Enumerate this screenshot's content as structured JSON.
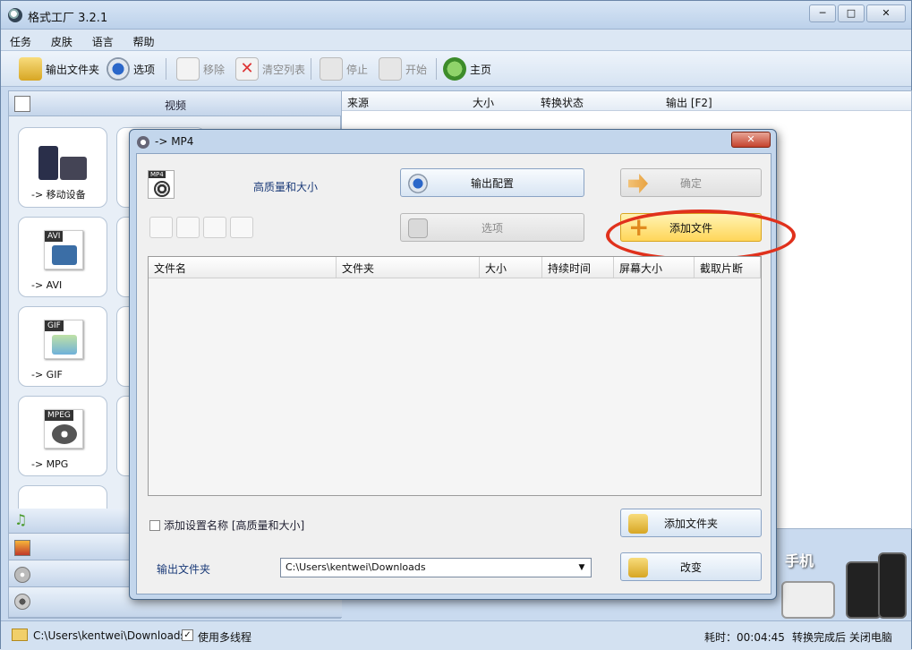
{
  "app": {
    "title": "格式工厂 3.2.1"
  },
  "window_controls": {
    "minimize": "─",
    "maximize": "□",
    "close": "✕"
  },
  "menu": [
    "任务",
    "皮肤",
    "语言",
    "帮助"
  ],
  "toolbar": {
    "output_folder": "输出文件夹",
    "options": "选项",
    "remove": "移除",
    "clear_list": "清空列表",
    "stop": "停止",
    "start": "开始",
    "home": "主页"
  },
  "left_panel": {
    "video_header": "视频",
    "tiles": [
      "-> 移动设备",
      "-> AVI",
      "-> GIF",
      "-> MPG"
    ],
    "tile_tags": [
      "AVI",
      "GIF",
      "MPEG"
    ]
  },
  "task_list": {
    "columns": [
      "来源",
      "大小",
      "转换状态",
      "输出 [F2]"
    ]
  },
  "promo": {
    "label": "手机"
  },
  "status_bar": {
    "path": "C:\\Users\\kentwei\\Downloads",
    "multithread": "使用多线程",
    "elapsed": "耗时：00:04:45",
    "after": "转换完成后 关闭电脑"
  },
  "dialog": {
    "title": "-> MP4",
    "close": "✕",
    "profile_tag": "MP4",
    "profile_text": "高质量和大小",
    "output_config_button": "输出配置",
    "ok_button": "确定",
    "options_button": "选项",
    "add_file_button": "添加文件",
    "table_columns": [
      "文件名",
      "文件夹",
      "大小",
      "持续时间",
      "屏幕大小",
      "截取片断"
    ],
    "add_setting_label": "添加设置名称 [高质量和大小]",
    "add_folder_button": "添加文件夹",
    "output_label": "输出文件夹",
    "output_path": "C:\\Users\\kentwei\\Downloads",
    "change_button": "改变"
  }
}
